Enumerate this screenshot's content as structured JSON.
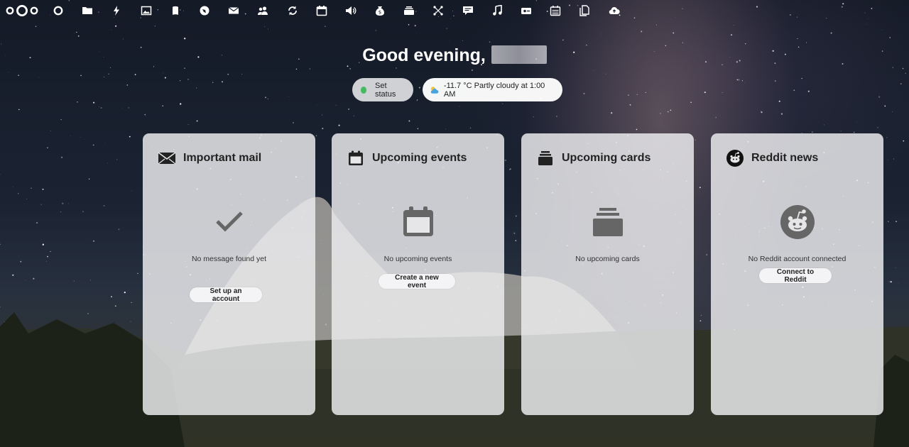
{
  "topbar": {
    "apps": [
      {
        "name": "dashboard"
      },
      {
        "name": "files"
      },
      {
        "name": "activity"
      },
      {
        "name": "photos"
      },
      {
        "name": "bookmarks"
      },
      {
        "name": "maps"
      },
      {
        "name": "mail"
      },
      {
        "name": "contacts"
      },
      {
        "name": "sync"
      },
      {
        "name": "calendar"
      },
      {
        "name": "announcements"
      },
      {
        "name": "cospend"
      },
      {
        "name": "deck"
      },
      {
        "name": "tools"
      },
      {
        "name": "talk"
      },
      {
        "name": "music"
      },
      {
        "name": "passwords"
      },
      {
        "name": "tasks"
      },
      {
        "name": "documents"
      },
      {
        "name": "cloud"
      }
    ]
  },
  "greeting": {
    "text": "Good evening,"
  },
  "status": {
    "label": "Set status",
    "dot_color": "#46ba61"
  },
  "weather": {
    "text": "-11.7 °C Partly cloudy at 1:00 AM"
  },
  "widgets": [
    {
      "title": "Important mail",
      "icon": "envelope-icon",
      "empty_icon": "checkmark-icon",
      "empty_text": "No message found yet",
      "button": "Set up an account"
    },
    {
      "title": "Upcoming events",
      "icon": "calendar-icon",
      "empty_icon": "calendar-icon",
      "empty_text": "No upcoming events",
      "button": "Create a new event"
    },
    {
      "title": "Upcoming cards",
      "icon": "deck-icon",
      "empty_icon": "deck-icon",
      "empty_text": "No upcoming cards",
      "button": ""
    },
    {
      "title": "Reddit news",
      "icon": "reddit-icon",
      "empty_icon": "reddit-icon",
      "empty_text": "No Reddit account connected",
      "button": "Connect to Reddit"
    }
  ]
}
